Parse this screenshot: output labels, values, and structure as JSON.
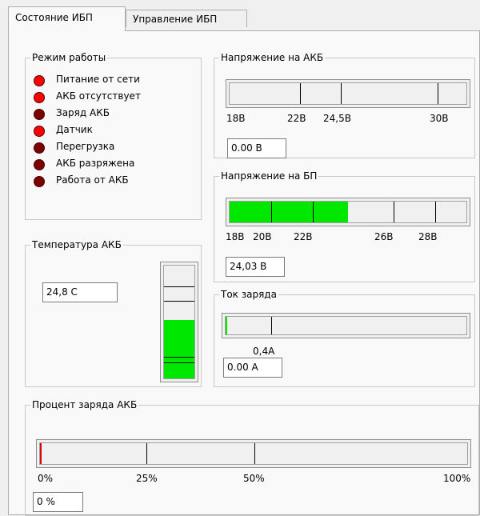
{
  "tabs": [
    {
      "label": "Состояние ИБП",
      "active": true
    },
    {
      "label": "Управление ИБП",
      "active": false
    }
  ],
  "mode": {
    "title": "Режим работы",
    "indicators": [
      {
        "label": "Питание от сети",
        "color": "#ff0000"
      },
      {
        "label": "АКБ отсутствует",
        "color": "#ff0000"
      },
      {
        "label": "Заряд АКБ",
        "color": "#7a0000"
      },
      {
        "label": "Датчик",
        "color": "#ff0000"
      },
      {
        "label": "Перегрузка",
        "color": "#7a0000"
      },
      {
        "label": "АКБ разряжена",
        "color": "#7a0000"
      },
      {
        "label": "Работа от АКБ",
        "color": "#7a0000"
      }
    ]
  },
  "battery_voltage": {
    "title": "Напряжение на АКБ",
    "ticks": [
      "18В",
      "22В",
      "24,5В",
      "30В"
    ],
    "value": "0.00 В",
    "fill_fraction": 0
  },
  "psu_voltage": {
    "title": "Напряжение на БП",
    "ticks": [
      "18В",
      "20В",
      "22В",
      "26В",
      "28В"
    ],
    "value": "24,03 В",
    "fill_fraction": 0.5
  },
  "temperature": {
    "title": "Температура АКБ",
    "value": "24,8 С",
    "fill_fraction": 0.52
  },
  "charge_current": {
    "title": "Ток заряда",
    "ticks": [
      "0,4А"
    ],
    "value": "0.00 А",
    "fill_fraction": 0
  },
  "charge_percent": {
    "title": "Процент заряда АКБ",
    "ticks": [
      "0%",
      "25%",
      "50%",
      "100%"
    ],
    "value": "0 %",
    "fill_fraction": 0
  },
  "colors": {
    "fill": "#00e800",
    "indicator_on": "#ff0000",
    "indicator_off": "#7a0000",
    "zero_marker": "#e00000"
  }
}
